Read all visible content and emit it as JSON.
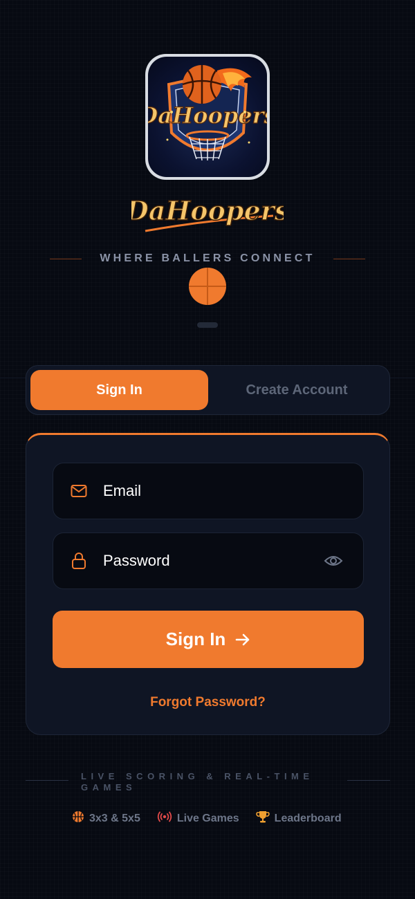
{
  "brand": {
    "name": "DaHoopers",
    "tagline": "WHERE BALLERS CONNECT"
  },
  "tabs": [
    {
      "label": "Sign In",
      "active": true
    },
    {
      "label": "Create Account",
      "active": false
    }
  ],
  "form": {
    "email_placeholder": "Email",
    "password_placeholder": "Password",
    "submit_label": "Sign In",
    "forgot_label": "Forgot Password?"
  },
  "footer": {
    "tagline": "LIVE SCORING & REAL-TIME GAMES",
    "features": [
      {
        "label": "3x3 & 5x5",
        "icon": "basketball-icon",
        "color": "#f07a2e"
      },
      {
        "label": "Live Games",
        "icon": "broadcast-icon",
        "color": "#e24a4a"
      },
      {
        "label": "Leaderboard",
        "icon": "trophy-icon",
        "color": "#f0a030"
      }
    ]
  },
  "colors": {
    "accent": "#f07a2e",
    "background": "#070a12",
    "card": "#0f1524"
  }
}
